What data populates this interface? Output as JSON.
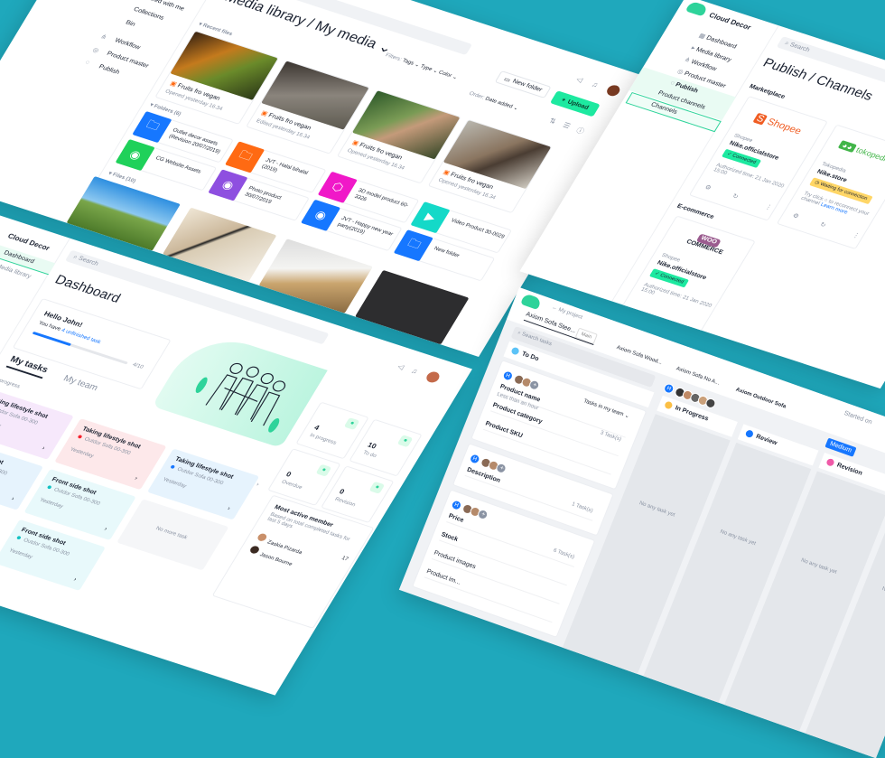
{
  "colors": {
    "background": "#1fa8bc",
    "accent": "#1de9a0",
    "link": "#1677ff"
  },
  "media": {
    "sidebar": [
      "Shared with me",
      "Collections",
      "Bin",
      "Workflow",
      "Product master",
      "Publish"
    ],
    "title": "Media library / My media",
    "filters_label": "Filters:",
    "filters": [
      "Tags",
      "Type",
      "Color"
    ],
    "new_folder": "New folder",
    "upload": "Upload",
    "order_label": "Order:",
    "order_value": "Date added",
    "recent_label": "Recent files",
    "recent": [
      {
        "name": "Fruits fro vegan",
        "meta": "Opened yesterday 16.34"
      },
      {
        "name": "Fruits fro vegan",
        "meta": "Edited yesterday 16.34"
      },
      {
        "name": "Fruits fro vegan",
        "meta": "Opened yesterday 16.34"
      },
      {
        "name": "Fruits fro vegan",
        "meta": "Opened yesterday 16.34"
      }
    ],
    "folders_label": "Folders (6)",
    "folders": [
      {
        "name": "Outlet decor assets (Revision 20/07/2019)",
        "color": "#1677ff",
        "icon": "folder"
      },
      {
        "name": "CG Website Assets",
        "color": "#1fd15a",
        "icon": "camera"
      },
      {
        "name": "JVT - Halal bihalal (2019)",
        "color": "#ff6a13",
        "icon": "folder"
      },
      {
        "name": "Photo product 30/07/2019",
        "color": "#8e4fe0",
        "icon": "camera"
      },
      {
        "name": "3D model product 60-3326",
        "color": "#f018c8",
        "icon": "cube"
      },
      {
        "name": "JVT - Happy new year party(2019)",
        "color": "#1677ff",
        "icon": "camera"
      },
      {
        "name": "Video Product 30-0029",
        "color": "#14d9c8",
        "icon": "video"
      },
      {
        "name": "New folder",
        "color": "#1677ff",
        "icon": "folder"
      }
    ],
    "files_label": "Files (10)"
  },
  "publish": {
    "brand": "Cloud Decor",
    "nav": [
      "Dashboard",
      "Media library",
      "Workflow",
      "Product master",
      "Publish",
      "Product channels",
      "Channels"
    ],
    "search": "Search",
    "title": "Publish / Channels",
    "marketplace": "Marketplace",
    "shopee": {
      "logo": "Shopee",
      "platform": "Shopee",
      "store": "Nike.officialstore",
      "status": "Connected",
      "auth": "Authorized time: 21 Jan 2020 15:00"
    },
    "tokopedia": {
      "logo": "tokopedia",
      "platform": "Tokopedia",
      "store": "Nike.store",
      "status": "Waiting for connection",
      "note": "Try click ○ to reconnect your channel",
      "link": "Learn more"
    },
    "ecommerce": "E-commerce",
    "woo": {
      "logo_top": "WOO",
      "logo_bottom": "COMMERCE",
      "platform": "Shopee",
      "store": "Nike.officialstore",
      "status": "Connected",
      "auth": "Authorized time: 21 Jan 2020 15:00"
    }
  },
  "dashboard": {
    "brand": "Cloud Decor",
    "nav": [
      "Dashboard",
      "Media library"
    ],
    "search": "Search",
    "title": "Dashboard",
    "hello": "Hello John!",
    "you_have": "You have",
    "unfinished": "4 unfinished task",
    "progress_text": "4/10",
    "progress_value": 0.4,
    "tabs": [
      "My tasks",
      "My team"
    ],
    "section": "In progress",
    "tasks": [
      {
        "title": "Taking lifestyle shot",
        "sub": "Outdor Sofa 00-300",
        "time": "Yesterday",
        "bg": "#f6e8fb",
        "dot": "#b36ae0"
      },
      {
        "title": "Taking lifestyle shot",
        "sub": "Outdor Sofa 00-300",
        "time": "Yesterday",
        "bg": "#fde8ea",
        "dot": "#f5222d"
      },
      {
        "title": "Taking lifestyle shot",
        "sub": "Outdor Sofa 00-300",
        "time": "Yesterday",
        "bg": "#e6f3fd",
        "dot": "#1677ff"
      },
      {
        "title": "Front side shot",
        "sub": "Outdor Sofa 00-300",
        "time": "Yesterday",
        "bg": "#e6f3fd",
        "dot": "#1677ff"
      },
      {
        "title": "Front side shot",
        "sub": "Outdor Sofa 00-300",
        "time": "Yesterday",
        "bg": "#e8f9fb",
        "dot": "#13c2c2"
      },
      {
        "title": "Front side shot",
        "sub": "Outdor Sofa 00-300",
        "time": "Yesterday",
        "bg": "#e8f9fb",
        "dot": "#13c2c2"
      }
    ],
    "no_more": "No more task",
    "stats": [
      {
        "value": "4",
        "label": "In progress"
      },
      {
        "value": "10",
        "label": "To do"
      },
      {
        "value": "0",
        "label": "Overdue"
      },
      {
        "value": "0",
        "label": "Revision"
      }
    ],
    "most_active": {
      "title": "Most active member",
      "sub": "Based on total completed tasks for last 5 days",
      "members": [
        {
          "name": "Zaskia Pizarda",
          "count": "17"
        },
        {
          "name": "Jason Bourne",
          "count": ""
        }
      ]
    }
  },
  "kanban": {
    "back": "My project",
    "tabs": [
      "Axiom Sofa Stee...",
      "Axiom Sofa Wood...",
      "Axiom Sofa No A...",
      "Axiom Outdoor Sofa"
    ],
    "main_badge": "Main",
    "search": "Search tasks",
    "started": "Started on",
    "avatar_initial": "H",
    "team_filter": "Tasks in my team",
    "todo": {
      "name": "To Do",
      "color": "#5cc3f7"
    },
    "columns": [
      {
        "name": "In Progress",
        "color": "#fbbf45"
      },
      {
        "name": "Review",
        "color": "#1677ff"
      },
      {
        "name": "Revision",
        "color": "#f05aa8"
      }
    ],
    "empty": "No any task yet",
    "medium": "Medium",
    "groups": [
      {
        "items": [
          "Product name",
          "Product category",
          "Product SKU"
        ],
        "sub": "Less than an hour",
        "count": "3 Task(s)"
      },
      {
        "items": [
          "Description"
        ],
        "count": "1 Task(s)"
      },
      {
        "items": [
          "Price",
          "Stock",
          "Product images",
          "Product im..."
        ],
        "count": "6 Task(s)"
      }
    ]
  }
}
